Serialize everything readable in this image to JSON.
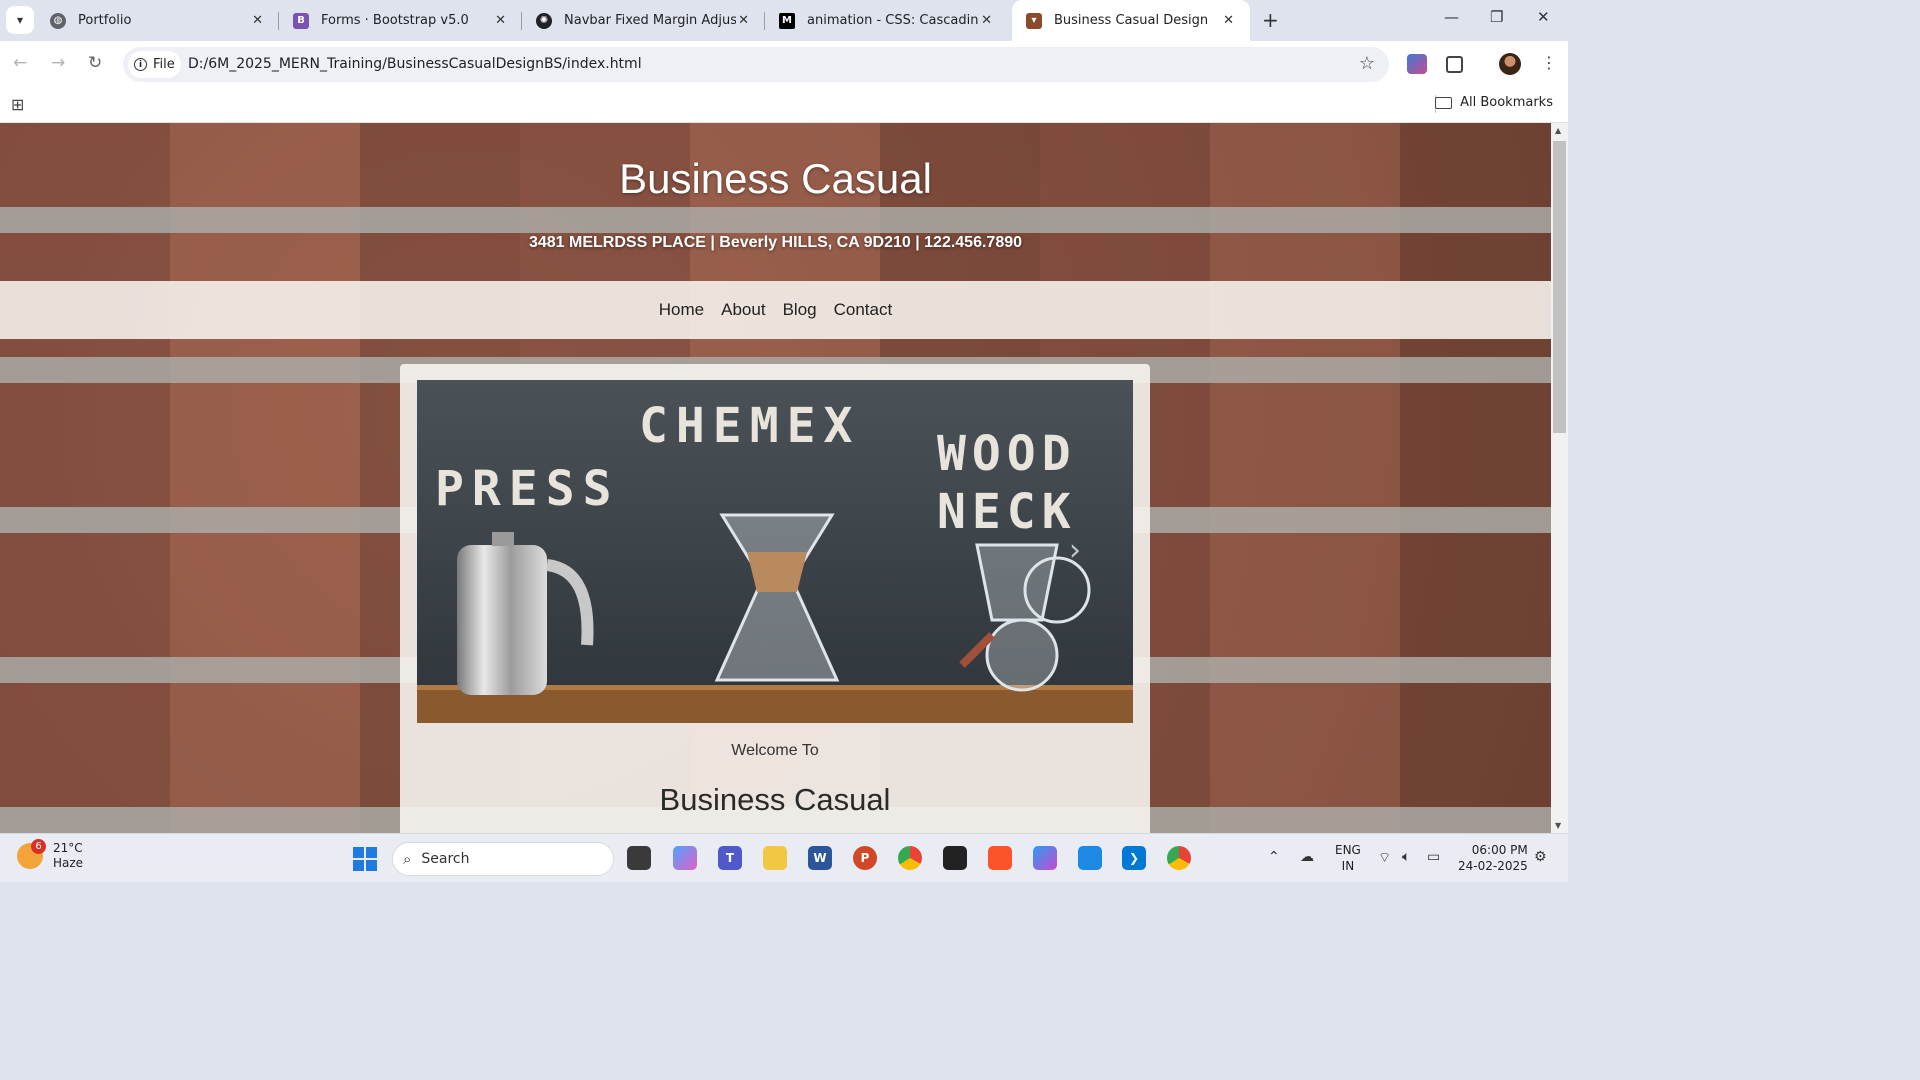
{
  "browser": {
    "tabs": [
      {
        "title": "Portfolio",
        "icon": "globe-icon",
        "color": "#5f6368"
      },
      {
        "title": "Forms · Bootstrap v5.0",
        "icon": "bootstrap-icon",
        "color": "#7952b3"
      },
      {
        "title": "Navbar Fixed Margin Adjust",
        "icon": "openai-icon",
        "color": "#202124"
      },
      {
        "title": "animation - CSS: Cascading Styl",
        "icon": "mdn-icon",
        "color": "#000000"
      },
      {
        "title": "Business Casual Design",
        "icon": "coffee-icon",
        "color": "#8d4a2a",
        "active": true
      }
    ],
    "address": {
      "scheme_label": "File",
      "url": "D:/6M_2025_MERN_Training/BusinessCasualDesignBS/index.html"
    },
    "bookmarks": {
      "all_label": "All Bookmarks"
    }
  },
  "page": {
    "title": "Business Casual",
    "address_line": "3481 MELRDSS PLACE | Beverly HILLS, CA 9D210 | 122.456.7890",
    "nav": [
      "Home",
      "About",
      "Blog",
      "Contact"
    ],
    "hero_text": {
      "press": "PRESS",
      "chemex": "CHEMEX",
      "wood": "WOOD",
      "neck": "NECK"
    },
    "welcome": "Welcome To",
    "heading": "Business Casual"
  },
  "taskbar": {
    "weather": {
      "temp": "21°C",
      "condition": "Haze",
      "badge": "6"
    },
    "search_placeholder": "Search",
    "lang_top": "ENG",
    "lang_bottom": "IN",
    "time": "06:00 PM",
    "date": "24-02-2025"
  }
}
